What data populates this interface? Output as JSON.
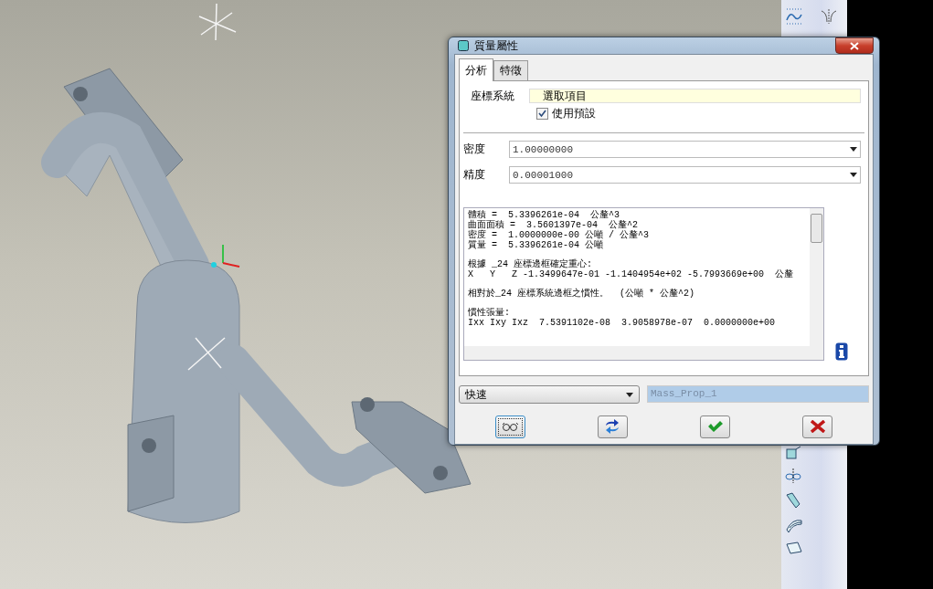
{
  "dialog": {
    "title": "質量屬性",
    "tabs": [
      {
        "label": "分析",
        "selected": true
      },
      {
        "label": "特徵",
        "selected": false
      }
    ],
    "coordinate_system": {
      "label": "座標系統",
      "value": "選取項目",
      "use_default": {
        "label": "使用預設",
        "checked": true
      }
    },
    "density": {
      "label": "密度",
      "value": "1.00000000"
    },
    "accuracy": {
      "label": "精度",
      "value": "0.00001000"
    },
    "results": [
      [
        "體積 =  5.3396261e-04  公釐^3",
        "曲面面積 =  3.5601397e-04  公釐^2",
        "密度 =  1.0000000e-00 公噸 / 公釐^3",
        "質量 =  5.3396261e-04 公噸"
      ],
      [
        "根據 _24 座標邊框確定重心:",
        "X   Y   Z -1.3499647e-01 -1.1404954e+02 -5.7993669e+00  公釐"
      ],
      [
        "相對於_24 座標系統邊框之慣性。  (公噸 * 公釐^2)"
      ],
      [
        "慣性張量:",
        "Ixx Ixy Ixz  7.5391102e-08  3.9058978e-07  0.0000000e+00"
      ]
    ],
    "mode": {
      "value": "快速"
    },
    "feature_name": {
      "value": "Mass_Prop_1"
    },
    "buttons": [
      {
        "kind": "preview"
      },
      {
        "kind": "repeat"
      },
      {
        "kind": "ok"
      },
      {
        "kind": "cancel"
      }
    ]
  },
  "toolbar": [
    {
      "kind": "curve"
    },
    {
      "kind": "mirror"
    },
    {
      "kind": "extend"
    },
    {
      "kind": "intersect"
    },
    {
      "kind": "sweep"
    },
    {
      "kind": "surface"
    },
    {
      "kind": "plane"
    }
  ]
}
